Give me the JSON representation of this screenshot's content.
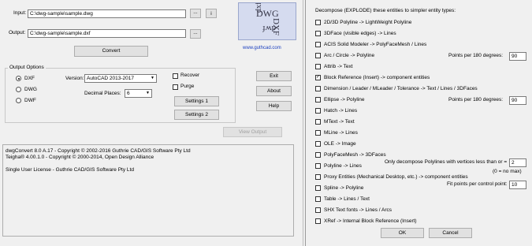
{
  "main": {
    "input_label": "Input:",
    "input_value": "C:\\dwg-sample\\sample.dwg",
    "output_label": "Output:",
    "output_value": "C:\\dwg-sample\\sample.dxf",
    "browse_label": "...",
    "info_label": "i",
    "convert_label": "Convert",
    "logo_text": [
      "DWG",
      "DXF",
      "dwf",
      "dxf"
    ],
    "website": "www.guthcad.com",
    "output_options_title": "Output Options",
    "format_dxf": "DXF",
    "format_dwg": "DWG",
    "format_dwf": "DWF",
    "version_label": "Version:",
    "version_value": "AutoCAD 2013-2017",
    "decimal_label": "Decimal Places:",
    "decimal_value": "6",
    "recover_label": "Recover",
    "purge_label": "Purge",
    "settings1_label": "Settings 1",
    "settings2_label": "Settings 2",
    "exit_label": "Exit",
    "about_label": "About",
    "help_label": "Help",
    "view_output_label": "View Output",
    "info_lines": [
      "dwgConvert 8.0 A.17 - Copyright © 2002-2016 Guthrie CAD/GIS Software Pty Ltd",
      "Teigha® 4.00.1.0 - Copyright © 2000-2014, Open Design Alliance",
      "",
      "Single User License - Guthrie CAD/GIS Software Pty Ltd"
    ]
  },
  "settings": {
    "header": "Decompose (EXPLODE) these entities to simpler entity types:",
    "items": [
      {
        "label": "2D/3D Polyline -> LightWeight Polyline",
        "checked": false
      },
      {
        "label": "3DFace (visible edges) -> Lines",
        "checked": false
      },
      {
        "label": "ACIS Solid Modeler -> PolyFaceMesh / Lines",
        "checked": false
      },
      {
        "label": "Arc / Circle -> Polyline",
        "checked": false
      },
      {
        "label": "Attrib -> Text",
        "checked": false
      },
      {
        "label": "Block Reference (Insert) -> component entities",
        "checked": true
      },
      {
        "label": "Dimension / Leader / MLeader / Tolerance -> Text / Lines / 3DFaces",
        "checked": false
      },
      {
        "label": "Ellipse -> Polyline",
        "checked": false
      },
      {
        "label": "Hatch -> Lines",
        "checked": false
      },
      {
        "label": "MText -> Text",
        "checked": false
      },
      {
        "label": "MLine -> Lines",
        "checked": false
      },
      {
        "label": "OLE -> Image",
        "checked": false
      },
      {
        "label": "PolyFaceMesh -> 3DFaces",
        "checked": false
      },
      {
        "label": "Polyline -> Lines",
        "checked": false
      },
      {
        "label": "Proxy Entities (Mechanical Desktop, etc.) -> component entities",
        "checked": false
      },
      {
        "label": "Spline -> Polyline",
        "checked": false
      },
      {
        "label": "Table -> Lines / Text",
        "checked": false
      },
      {
        "label": "SHX Text fonts -> Lines / Arcs",
        "checked": false
      },
      {
        "label": "XRef -> Internal Block Reference (Insert)",
        "checked": false
      }
    ],
    "arc_points_label": "Points per 180 degrees:",
    "arc_points_value": "90",
    "ellipse_points_label": "Points per 180 degrees:",
    "ellipse_points_value": "90",
    "polyline_vertices_label": "Only decompose Polylines with vertices less than or =",
    "polyline_vertices_value": "2",
    "proxy_note": "(0 = no max)",
    "spline_points_label": "Fit points per control point:",
    "spline_points_value": "10",
    "ok_label": "OK",
    "cancel_label": "Cancel"
  }
}
